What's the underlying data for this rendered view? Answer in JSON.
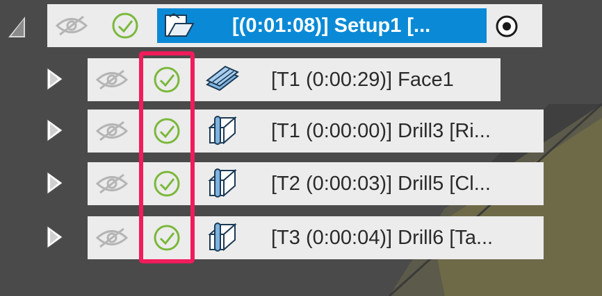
{
  "setup": {
    "label": "[(0:01:08)] Setup1 [..."
  },
  "operations": [
    {
      "label": "[T1 (0:00:29)] Face1",
      "type": "face"
    },
    {
      "label": "[T1 (0:00:00)] Drill3 [Ri...",
      "type": "drill"
    },
    {
      "label": "[T2 (0:00:03)] Drill5 [Cl...",
      "type": "drill"
    },
    {
      "label": "[T3 (0:00:04)] Drill6 [Ta...",
      "type": "drill"
    }
  ],
  "colors": {
    "selection_blue": "#0a8ad6",
    "check_green": "#7ab83a",
    "highlight_pink": "#f01c5c",
    "row_bg": "#ececec"
  }
}
